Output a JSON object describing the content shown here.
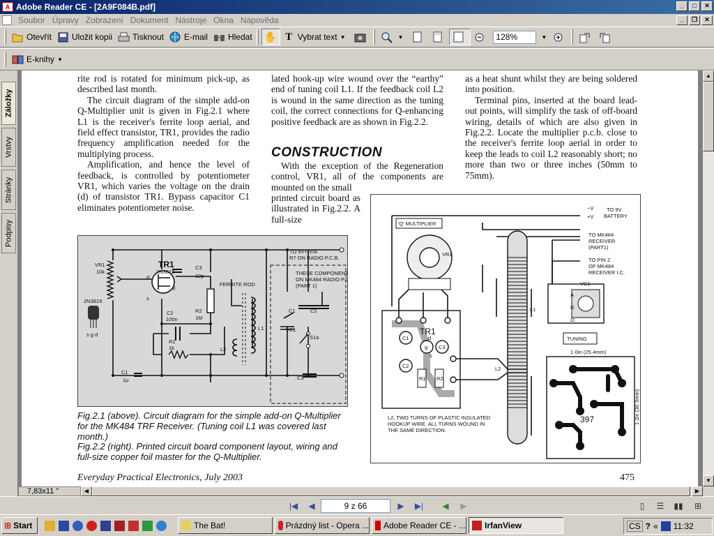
{
  "window": {
    "title": "Adobe Reader CE - [2A9F084B.pdf]"
  },
  "menu": [
    "Soubor",
    "Úpravy",
    "Zobrazení",
    "Dokument",
    "Nástroje",
    "Okna",
    "Nápověda"
  ],
  "toolbar": {
    "open": "Otevřít",
    "save_copy": "Uložit kopii",
    "print": "Tisknout",
    "email": "E-mail",
    "search": "Hledat",
    "select_text": "Vybrat text",
    "zoom": "128%",
    "ebooks": "E-knihy"
  },
  "side_tabs": [
    "Záložky",
    "Vrstvy",
    "Stránky",
    "Podpisy"
  ],
  "page": {
    "col1": [
      "rite rod is rotated for minimum pick-up, as described last month.",
      "The circuit diagram of the simple add-on Q-Multiplier unit is given in Fig.2.1 where L1 is the receiver's ferrite loop aerial, and field effect transistor, TR1, provides the radio frequency amplification needed for the multiplying process.",
      "Amplification, and hence the level of feedback, is controlled by potentiometer VR1, which varies the voltage on the drain (d) of transistor TR1. Bypass capacitor C1 eliminates potentiometer noise."
    ],
    "col2_top": "lated hook-up wire wound over the “earthy” end of tuning coil L1. If the feedback coil L2 is wound in the same direction as the tuning coil, the correct connections for Q-enhancing positive feedback are as shown in Fig.2.2.",
    "heading": "CONSTRUCTION",
    "col2_bottom_wide": "With the exception of the Regeneration control, VR1, all of the components are mounted on the small",
    "col2_bottom_narrow": "printed circuit board as illustrated in Fig.2.2. A full-size",
    "col3": [
      "as a heat shunt whilst they are being soldered into position.",
      "Terminal pins, inserted at the board lead-out points, will simplify the task of off-board wiring, details of which are also given in Fig.2.2. Locate the multiplier p.c.b. close to the receiver's ferrite loop aerial in order to keep the leads to coil L2 reasonably short; no more than two or three inches (50mm to 75mm)."
    ],
    "fig1_labels": {
      "vr1": "VR1",
      "vr1v": "10k",
      "tr1": "TR1",
      "tr1v": "2N3819",
      "c3": "C3",
      "c3v": "22p",
      "supply1": "TO 9V+ VIA",
      "supply2": "R7 ON RADIO P.C.B.",
      "note1": "THESE COMPONENTS",
      "note2": "ON MK484 RADIO P.C.B.",
      "note3": "(PART 1)",
      "ferrite": "FERRITE ROD",
      "c2": "C2",
      "c2v": "100n",
      "r2": "R2",
      "r2v": "1M",
      "r1": "R1",
      "r1v": "1k",
      "c1": "C1",
      "c1v": "1µ",
      "l1": "L1",
      "l2": "L2",
      "vc1": "VC1",
      "s1a": "S1a",
      "c1b": "C1",
      "c2b": "C2",
      "c3b": "C3",
      "pinout": "2N3819",
      "pins": "s g d",
      "d": "d",
      "g": "g",
      "s": "s"
    },
    "fig2_labels": {
      "qmult": "'Q' MULTIPLIER",
      "vr1": "VR1",
      "neg": "−V",
      "pos": "+V",
      "batt1": "TO 9V",
      "batt2": "BATTERY",
      "rx1": "TO MK484",
      "rx2": "RECEIVER",
      "rx3": "(PART1)",
      "pin1": "TO PIN 2",
      "pin2": "OF MK484",
      "pin3": "RECEIVER I.C.",
      "vc1": "VC1",
      "a": "A",
      "g": "G",
      "o": "O",
      "tuning": "TUNING",
      "l1": "L1",
      "l2": "L2",
      "tr1": "TR1",
      "c1": "C1",
      "c2": "C2",
      "c3": "C3",
      "r1": "R1",
      "r2": "R2",
      "d": "d",
      "g2": "g",
      "s": "s",
      "wire1": "L2, TWO TURNS OF PLASTIC INSULATED",
      "wire2": "HOOKUP WIRE. ALL TURNS WOUND IN",
      "wire3": "THE SAME DIRECTION.",
      "dimh": "1·0in (25·4mm)",
      "dimv": "1·2in (30·5mm)",
      "num": "397"
    },
    "caption1": "Fig.2.1 (above). Circuit diagram for the simple add-on Q-Multiplier for the MK484 TRF Receiver. (Tuning coil L1 was covered last month.)",
    "caption2": "Fig.2.2 (right). Printed circuit board component layout, wiring and full-size copper foil master for the Q-Multiplier.",
    "footer_left": "Everyday Practical Electronics, July 2003",
    "footer_right": "475"
  },
  "page_size": "7,83x11 \"",
  "nav": {
    "page": "9 z 66"
  },
  "taskbar": {
    "start": "Start",
    "tasks": [
      "The Bat!",
      "Prázdný list - Opera ...",
      "Adobe Reader CE - ...",
      "IrfanView"
    ],
    "lang": "CS",
    "clock": "11:32"
  },
  "colors": {
    "titlebar": "#0a246a",
    "figure_bg": "#d8d8d8",
    "taskbar": "#d4d0c8"
  }
}
